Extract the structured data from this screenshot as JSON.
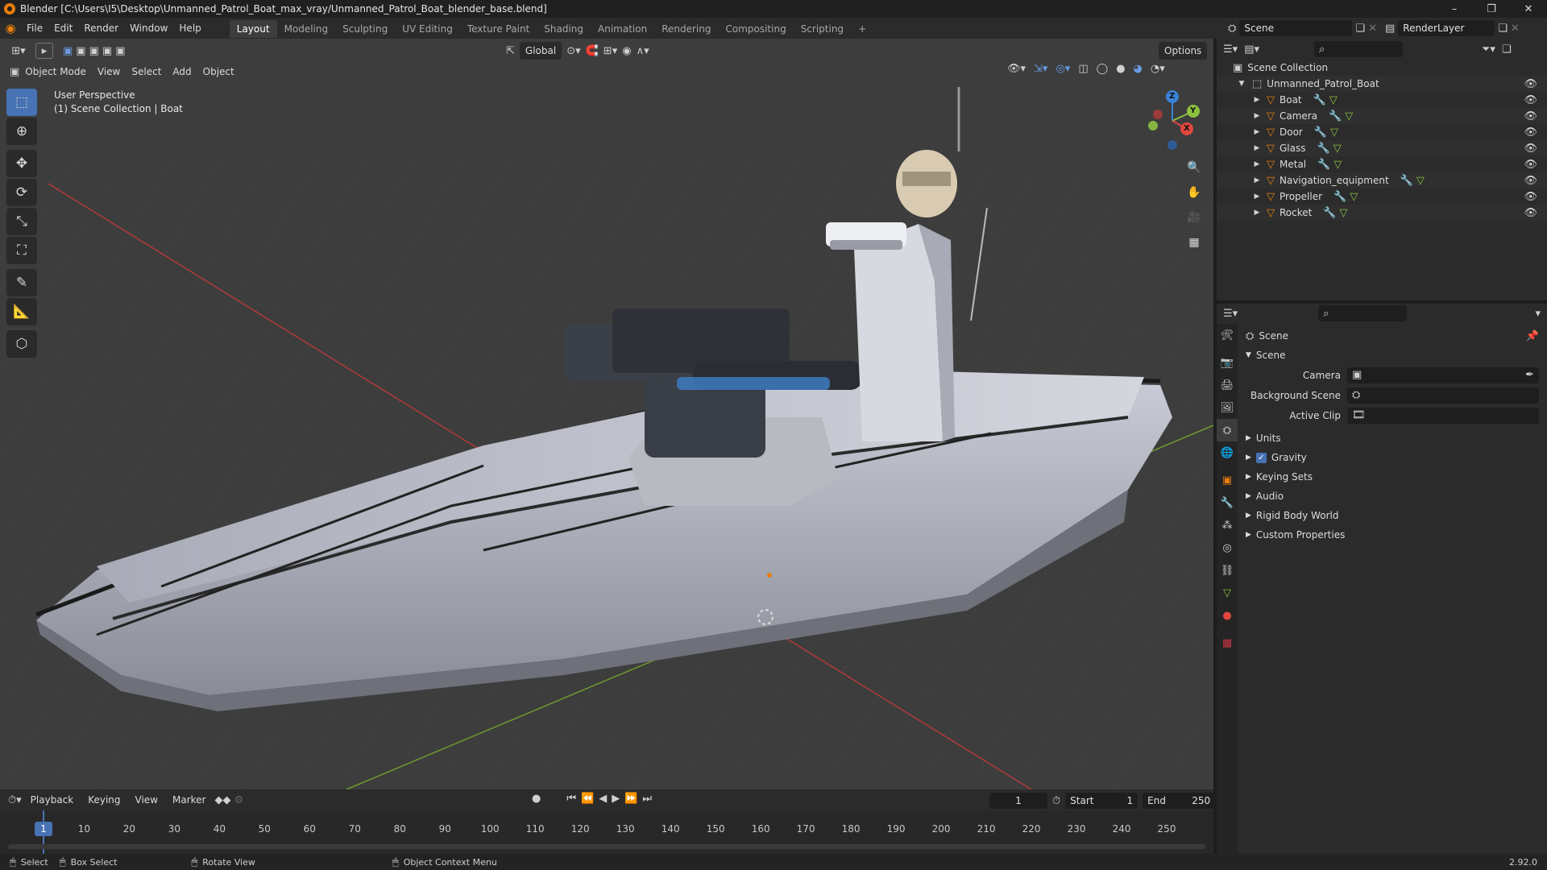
{
  "window": {
    "title": "Blender [C:\\Users\\I5\\Desktop\\Unmanned_Patrol_Boat_max_vray/Unmanned_Patrol_Boat_blender_base.blend]",
    "min": "–",
    "max": "❐",
    "close": "✕"
  },
  "menus": [
    "File",
    "Edit",
    "Render",
    "Window",
    "Help"
  ],
  "workspaces": [
    "Layout",
    "Modeling",
    "Sculpting",
    "UV Editing",
    "Texture Paint",
    "Shading",
    "Animation",
    "Rendering",
    "Compositing",
    "Scripting"
  ],
  "scene_field": "Scene",
  "renderlayer_field": "RenderLayer",
  "viewport": {
    "mode": "Object Mode",
    "menus": [
      "View",
      "Select",
      "Add",
      "Object"
    ],
    "orientation": "Global",
    "options": "Options",
    "info_line1": "User Perspective",
    "info_line2": "(1) Scene Collection | Boat",
    "gizmo_axes": [
      "Z",
      "Y",
      "X"
    ]
  },
  "outliner": {
    "root": "Scene Collection",
    "collection": "Unmanned_Patrol_Boat",
    "items": [
      "Boat",
      "Camera",
      "Door",
      "Glass",
      "Metal",
      "Navigation_equipment",
      "Propeller",
      "Rocket"
    ]
  },
  "properties": {
    "context": "Scene",
    "panel": "Scene",
    "fields": [
      {
        "label": "Camera"
      },
      {
        "label": "Background Scene"
      },
      {
        "label": "Active Clip"
      }
    ],
    "subpanels": [
      "Units",
      "Gravity",
      "Keying Sets",
      "Audio",
      "Rigid Body World",
      "Custom Properties"
    ],
    "gravity_checked": true
  },
  "timeline": {
    "menus": [
      "Playback",
      "Keying",
      "View",
      "Marker"
    ],
    "current_frame": "1",
    "start_label": "Start",
    "start": "1",
    "end_label": "End",
    "end": "250",
    "ticks": [
      "1",
      "10",
      "20",
      "30",
      "40",
      "50",
      "60",
      "70",
      "80",
      "90",
      "100",
      "110",
      "120",
      "130",
      "140",
      "150",
      "160",
      "170",
      "180",
      "190",
      "200",
      "210",
      "220",
      "230",
      "240",
      "250"
    ]
  },
  "status": {
    "select": "Select",
    "box_select": "Box Select",
    "rotate": "Rotate View",
    "context_menu": "Object Context Menu",
    "version": "2.92.0"
  },
  "colors": {
    "accent": "#4772b3",
    "orange": "#e87d0d",
    "x_axis": "#e0473d",
    "y_axis": "#8cc23f",
    "z_axis": "#3a82d6"
  }
}
